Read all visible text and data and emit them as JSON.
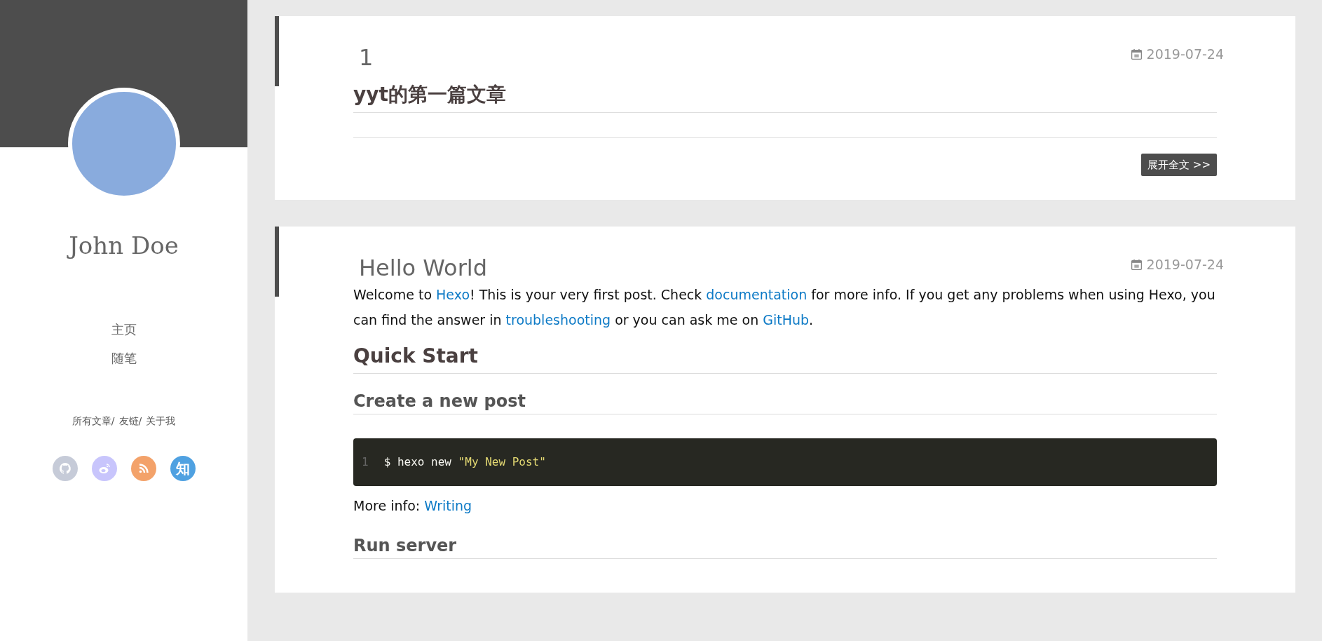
{
  "sidebar": {
    "author": "John Doe",
    "nav": [
      {
        "label": "主页"
      },
      {
        "label": "随笔"
      }
    ],
    "links": [
      {
        "label": "所有文章/"
      },
      {
        "label": "友链/"
      },
      {
        "label": "关于我"
      }
    ],
    "social": [
      {
        "kind": "github",
        "color": "#c6cbd8"
      },
      {
        "kind": "weibo",
        "color": "#c8c5fc"
      },
      {
        "kind": "rss",
        "color": "#f3a26a"
      },
      {
        "kind": "glyph",
        "glyph": "知",
        "color": "#4fa1e1"
      }
    ]
  },
  "posts": [
    {
      "title": "1",
      "date": "2019-07-24",
      "blocks": [
        {
          "kind": "h2",
          "text": "yyt的第一篇文章"
        },
        {
          "kind": "rule"
        }
      ],
      "more": "展开全文 >>"
    },
    {
      "title": "Hello World",
      "date": "2019-07-24",
      "blocks": [
        {
          "kind": "paragraph",
          "segments": [
            {
              "kind": "text",
              "text": "Welcome to "
            },
            {
              "kind": "link",
              "text": "Hexo"
            },
            {
              "kind": "text",
              "text": "! This is your very first post. Check "
            },
            {
              "kind": "link",
              "text": "documentation"
            },
            {
              "kind": "text",
              "text": " for more info. If you get any problems when using Hexo, you can find the answer in "
            },
            {
              "kind": "link",
              "text": "troubleshooting"
            },
            {
              "kind": "text",
              "text": " or you can ask me on "
            },
            {
              "kind": "link",
              "text": "GitHub"
            },
            {
              "kind": "text",
              "text": "."
            }
          ]
        },
        {
          "kind": "h2",
          "text": "Quick Start"
        },
        {
          "kind": "h3",
          "text": "Create a new post"
        },
        {
          "kind": "code",
          "line": "1",
          "code": "$ hexo new ",
          "string": "\"My New Post\""
        },
        {
          "kind": "paragraph",
          "segments": [
            {
              "kind": "text",
              "text": "More info: "
            },
            {
              "kind": "link",
              "text": "Writing"
            }
          ]
        },
        {
          "kind": "h3",
          "text": "Run server"
        }
      ]
    }
  ]
}
